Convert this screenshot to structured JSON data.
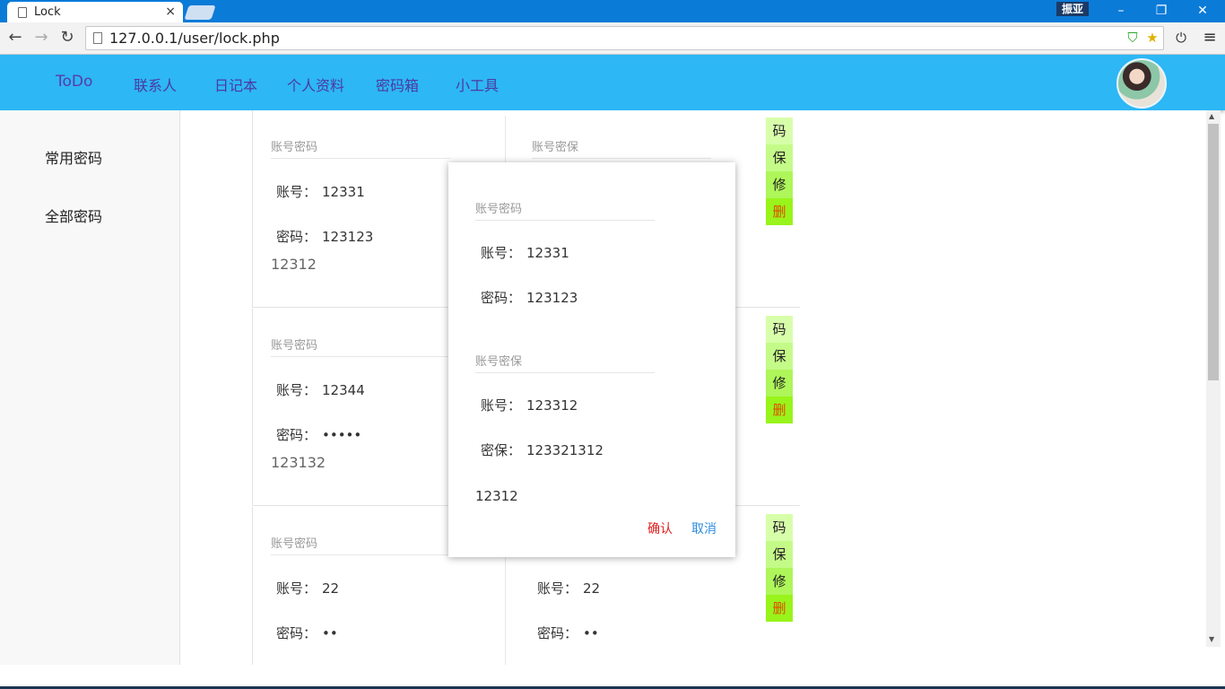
{
  "browser": {
    "tab_title": "Lock",
    "tab_close": "×",
    "url": "127.0.0.1/user/lock.php",
    "user_badge": "振亚",
    "win_min": "–",
    "win_max": "❐",
    "win_close": "✕",
    "back": "←",
    "forward": "→",
    "reload": "↻",
    "menu": "≡",
    "power": "⏻",
    "star": "★",
    "shield": "⛉"
  },
  "header": {
    "brand": "ToDo",
    "menu": [
      "联系人",
      "日记本",
      "个人资料",
      "密码箱",
      "小工具"
    ]
  },
  "sidebar": {
    "items": [
      "常用密码",
      "全部密码"
    ]
  },
  "labels": {
    "account_pw": "账号密码",
    "account_sec": "账号密保",
    "account": "账号：",
    "password": "密码：",
    "security": "密保："
  },
  "actions": [
    "码",
    "保",
    "修",
    "删"
  ],
  "cards": [
    {
      "left": {
        "account": "12331",
        "password": "123123"
      },
      "right_title": "账号密保",
      "note": "12312"
    },
    {
      "left": {
        "account": "12344",
        "password": "•••••"
      },
      "note": "123132"
    },
    {
      "left": {
        "account": "22",
        "password": "••"
      },
      "right": {
        "account": "22",
        "password": "••"
      }
    }
  ],
  "modal": {
    "pw_title": "账号密码",
    "account": "12331",
    "password": "123123",
    "sec_title": "账号密保",
    "sec_account": "123312",
    "sec_answer": "123321312",
    "note": "12312",
    "confirm": "确认",
    "cancel": "取消"
  },
  "colors": {
    "appbar": "#2db7f5",
    "action_1": "#d7ffaa",
    "action_2": "#c4fb88",
    "action_3": "#aef659",
    "action_4": "#98f41b"
  }
}
